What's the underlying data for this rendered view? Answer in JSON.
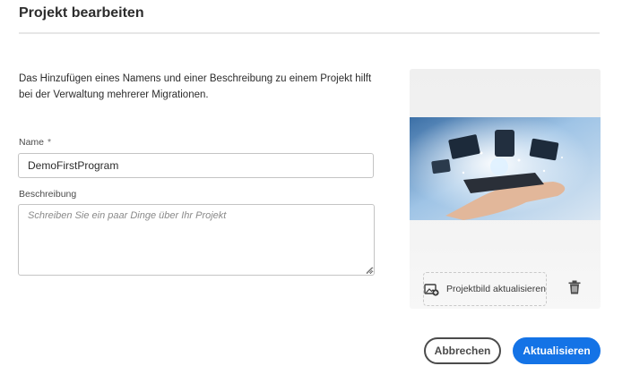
{
  "dialog": {
    "title": "Projekt bearbeiten",
    "description": "Das Hinzufügen eines Namens und einer Beschreibung zu einem Projekt hilft bei der Verwaltung mehrerer Migrationen."
  },
  "form": {
    "name_label": "Name",
    "required_marker": "*",
    "name_value": "DemoFirstProgram",
    "description_label": "Beschreibung",
    "description_placeholder": "Schreiben Sie ein paar Dinge über Ihr Projekt",
    "description_value": ""
  },
  "image_panel": {
    "update_image_label": "Projektbild aktualisieren",
    "update_image_icon": "image-add-icon",
    "delete_icon": "trash-icon"
  },
  "actions": {
    "cancel_label": "Abbrechen",
    "submit_label": "Aktualisieren"
  },
  "colors": {
    "primary": "#1473e6",
    "text": "#2c2c2c",
    "border": "#c4c4c4"
  }
}
